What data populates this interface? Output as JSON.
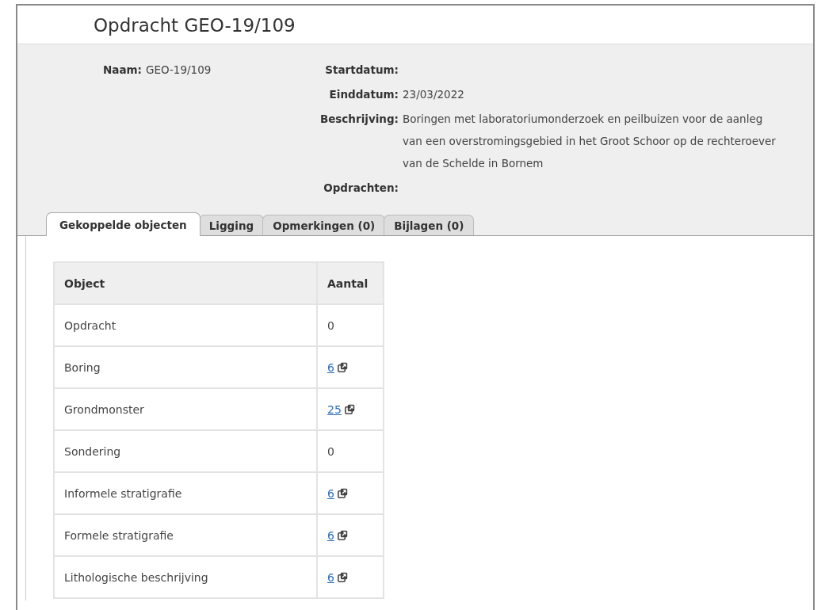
{
  "title": "Opdracht GEO-19/109",
  "details_left": [
    {
      "label": "Naam:",
      "value": "GEO-19/109"
    }
  ],
  "details_right": [
    {
      "label": "Startdatum:"
    },
    {
      "label": "Einddatum:",
      "value": "23/03/2022"
    },
    {
      "label": "Beschrijving:",
      "value": "Boringen met laboratoriumonderzoek en peilbuizen voor de aanleg van een overstromingsgebied in het Groot Schoor op de rechteroever van de Schelde in Bornem"
    },
    {
      "label": "Opdrachten:"
    }
  ],
  "tabs": [
    {
      "label": "Gekoppelde objecten",
      "selected": true
    },
    {
      "label": "Ligging",
      "selected": false
    },
    {
      "label": "Opmerkingen (0)",
      "selected": false
    },
    {
      "label": "Bijlagen (0)",
      "selected": false
    }
  ],
  "table": {
    "columns": [
      "Object",
      "Aantal"
    ],
    "rows": [
      {
        "object": "Opdracht",
        "count": "0",
        "kind": "plain"
      },
      {
        "object": "Boring",
        "count": "6",
        "kind": "link"
      },
      {
        "object": "Grondmonster",
        "count": "25",
        "kind": "link"
      },
      {
        "object": "Sondering",
        "count": "0",
        "kind": "plain"
      },
      {
        "object": "Informele stratigrafie",
        "count": "6",
        "kind": "link"
      },
      {
        "object": "Formele stratigrafie",
        "count": "6",
        "kind": "link"
      },
      {
        "object": "Lithologische beschrijving",
        "count": "6",
        "kind": "link"
      }
    ]
  }
}
